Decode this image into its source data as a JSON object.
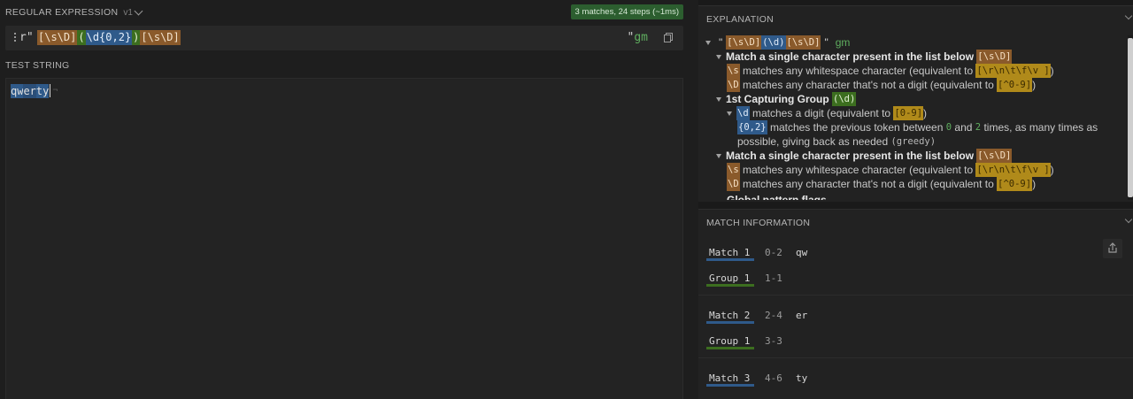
{
  "regex": {
    "section_label": "REGULAR EXPRESSION",
    "version": "v1",
    "status_badge": "3 matches, 24 steps (~1ms)",
    "delimiter_open": "r\"",
    "tokens": {
      "set1": "[\\s\\D]",
      "group_open": "(",
      "group_digit": "\\d{0,2}",
      "group_close": ")",
      "set2": "[\\s\\D]"
    },
    "delimiter_close": "\"",
    "flags": "gm"
  },
  "test": {
    "section_label": "TEST STRING",
    "segment_a": "qw",
    "segment_b": "er",
    "segment_c": "ty",
    "eol_mark": "¬"
  },
  "explanation": {
    "section_label": "EXPLANATION",
    "header_quote_open": "\"",
    "header_set1": "[\\s\\D]",
    "header_group": "(\\d)",
    "header_set2": "[\\s\\D]",
    "header_quote_close": "\"",
    "header_flags": "gm",
    "set1_title": "Match a single character present in the list below",
    "set1_token": "[\\s\\D]",
    "s_token": "\\s",
    "s_desc": "matches any whitespace character (equivalent to",
    "s_equiv": "[\\r\\n\\t\\f\\v  ]",
    "close_paren": ")",
    "D_token": "\\D",
    "D_desc": "matches any character that's not a digit (equivalent to",
    "D_equiv": "[^0-9]",
    "group_title": "1st Capturing Group",
    "group_token": "(\\d)",
    "d_token": "\\d",
    "d_desc": "matches a digit (equivalent to",
    "d_equiv": "[0-9]",
    "quant_token": "{0,2}",
    "quant_desc_1": "matches the previous token between",
    "quant_min": "0",
    "quant_and": "and",
    "quant_max": "2",
    "quant_desc_2": "times, as many times as",
    "quant_desc_3": "possible, giving back as needed",
    "quant_greedy": "(greedy)",
    "set2_title": "Match a single character present in the list below",
    "set2_token": "[\\s\\D]",
    "global_cut": "Global pattern flags"
  },
  "match_info": {
    "section_label": "MATCH INFORMATION",
    "rows": [
      {
        "name": "Match 1",
        "range": "0-2",
        "value": "qw"
      },
      {
        "name": "Group 1",
        "range": "1-1",
        "value": ""
      },
      {
        "name": "Match 2",
        "range": "2-4",
        "value": "er"
      },
      {
        "name": "Group 1",
        "range": "3-3",
        "value": ""
      },
      {
        "name": "Match 3",
        "range": "4-6",
        "value": "ty"
      }
    ]
  },
  "colors": {
    "set": "#8a5a2b",
    "group": "#2f5a8a",
    "group_outer": "#3c6e1f",
    "equiv": "#b08a1a",
    "badge": "#2c5e2f"
  }
}
